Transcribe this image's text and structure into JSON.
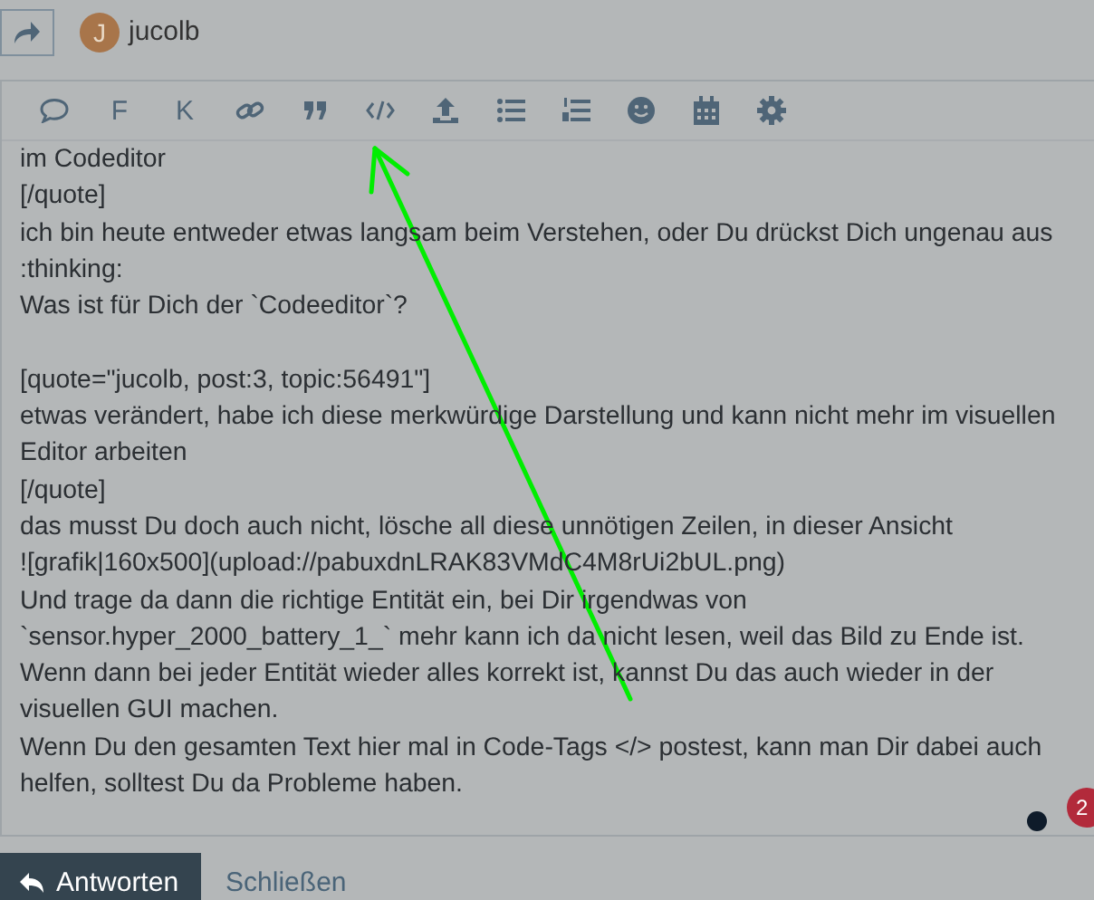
{
  "header": {
    "avatar_letter": "J",
    "username": "jucolb"
  },
  "toolbar": [
    {
      "kind": "icon"
    },
    {
      "kind": "letter",
      "text": "F"
    },
    {
      "kind": "letter",
      "text": "K"
    },
    {
      "kind": "icon"
    },
    {
      "kind": "icon"
    },
    {
      "kind": "icon"
    },
    {
      "kind": "icon"
    },
    {
      "kind": "icon"
    },
    {
      "kind": "icon"
    },
    {
      "kind": "icon"
    },
    {
      "kind": "icon"
    },
    {
      "kind": "icon"
    }
  ],
  "editor_lines": [
    "im Codeditor",
    "[/quote]",
    "ich bin heute entweder etwas langsam beim Verstehen, oder Du drückst Dich ungenau aus",
    ":thinking:",
    "Was ist für Dich der `Codeeditor`?",
    "[quote=\"jucolb, post:3, topic:56491\"]",
    "etwas verändert, habe ich diese merkwürdige Darstellung und kann nicht mehr im visuellen",
    "Editor arbeiten",
    "[/quote]",
    "das musst Du doch auch nicht, lösche all diese unnötigen Zeilen, in dieser Ansicht",
    "![grafik|160x500](upload://pabuxdnLRAK83VMdC4M8rUi2bUL.png)",
    "Und trage da dann die richtige Entität ein, bei Dir irgendwas von",
    "`sensor.hyper_2000_battery_1_` mehr kann ich da nicht lesen, weil das Bild zu Ende ist.",
    "Wenn dann bei jeder Entität wieder alles korrekt ist, kannst Du das auch wieder in der",
    "visuellen GUI machen.",
    "Wenn Du den gesamten Text hier mal in Code-Tags </> postest, kann man Dir dabei auch",
    "helfen, solltest Du da Probleme haben."
  ],
  "notification_badge": "2",
  "buttons": {
    "reply": "Antworten",
    "close": "Schließen"
  }
}
